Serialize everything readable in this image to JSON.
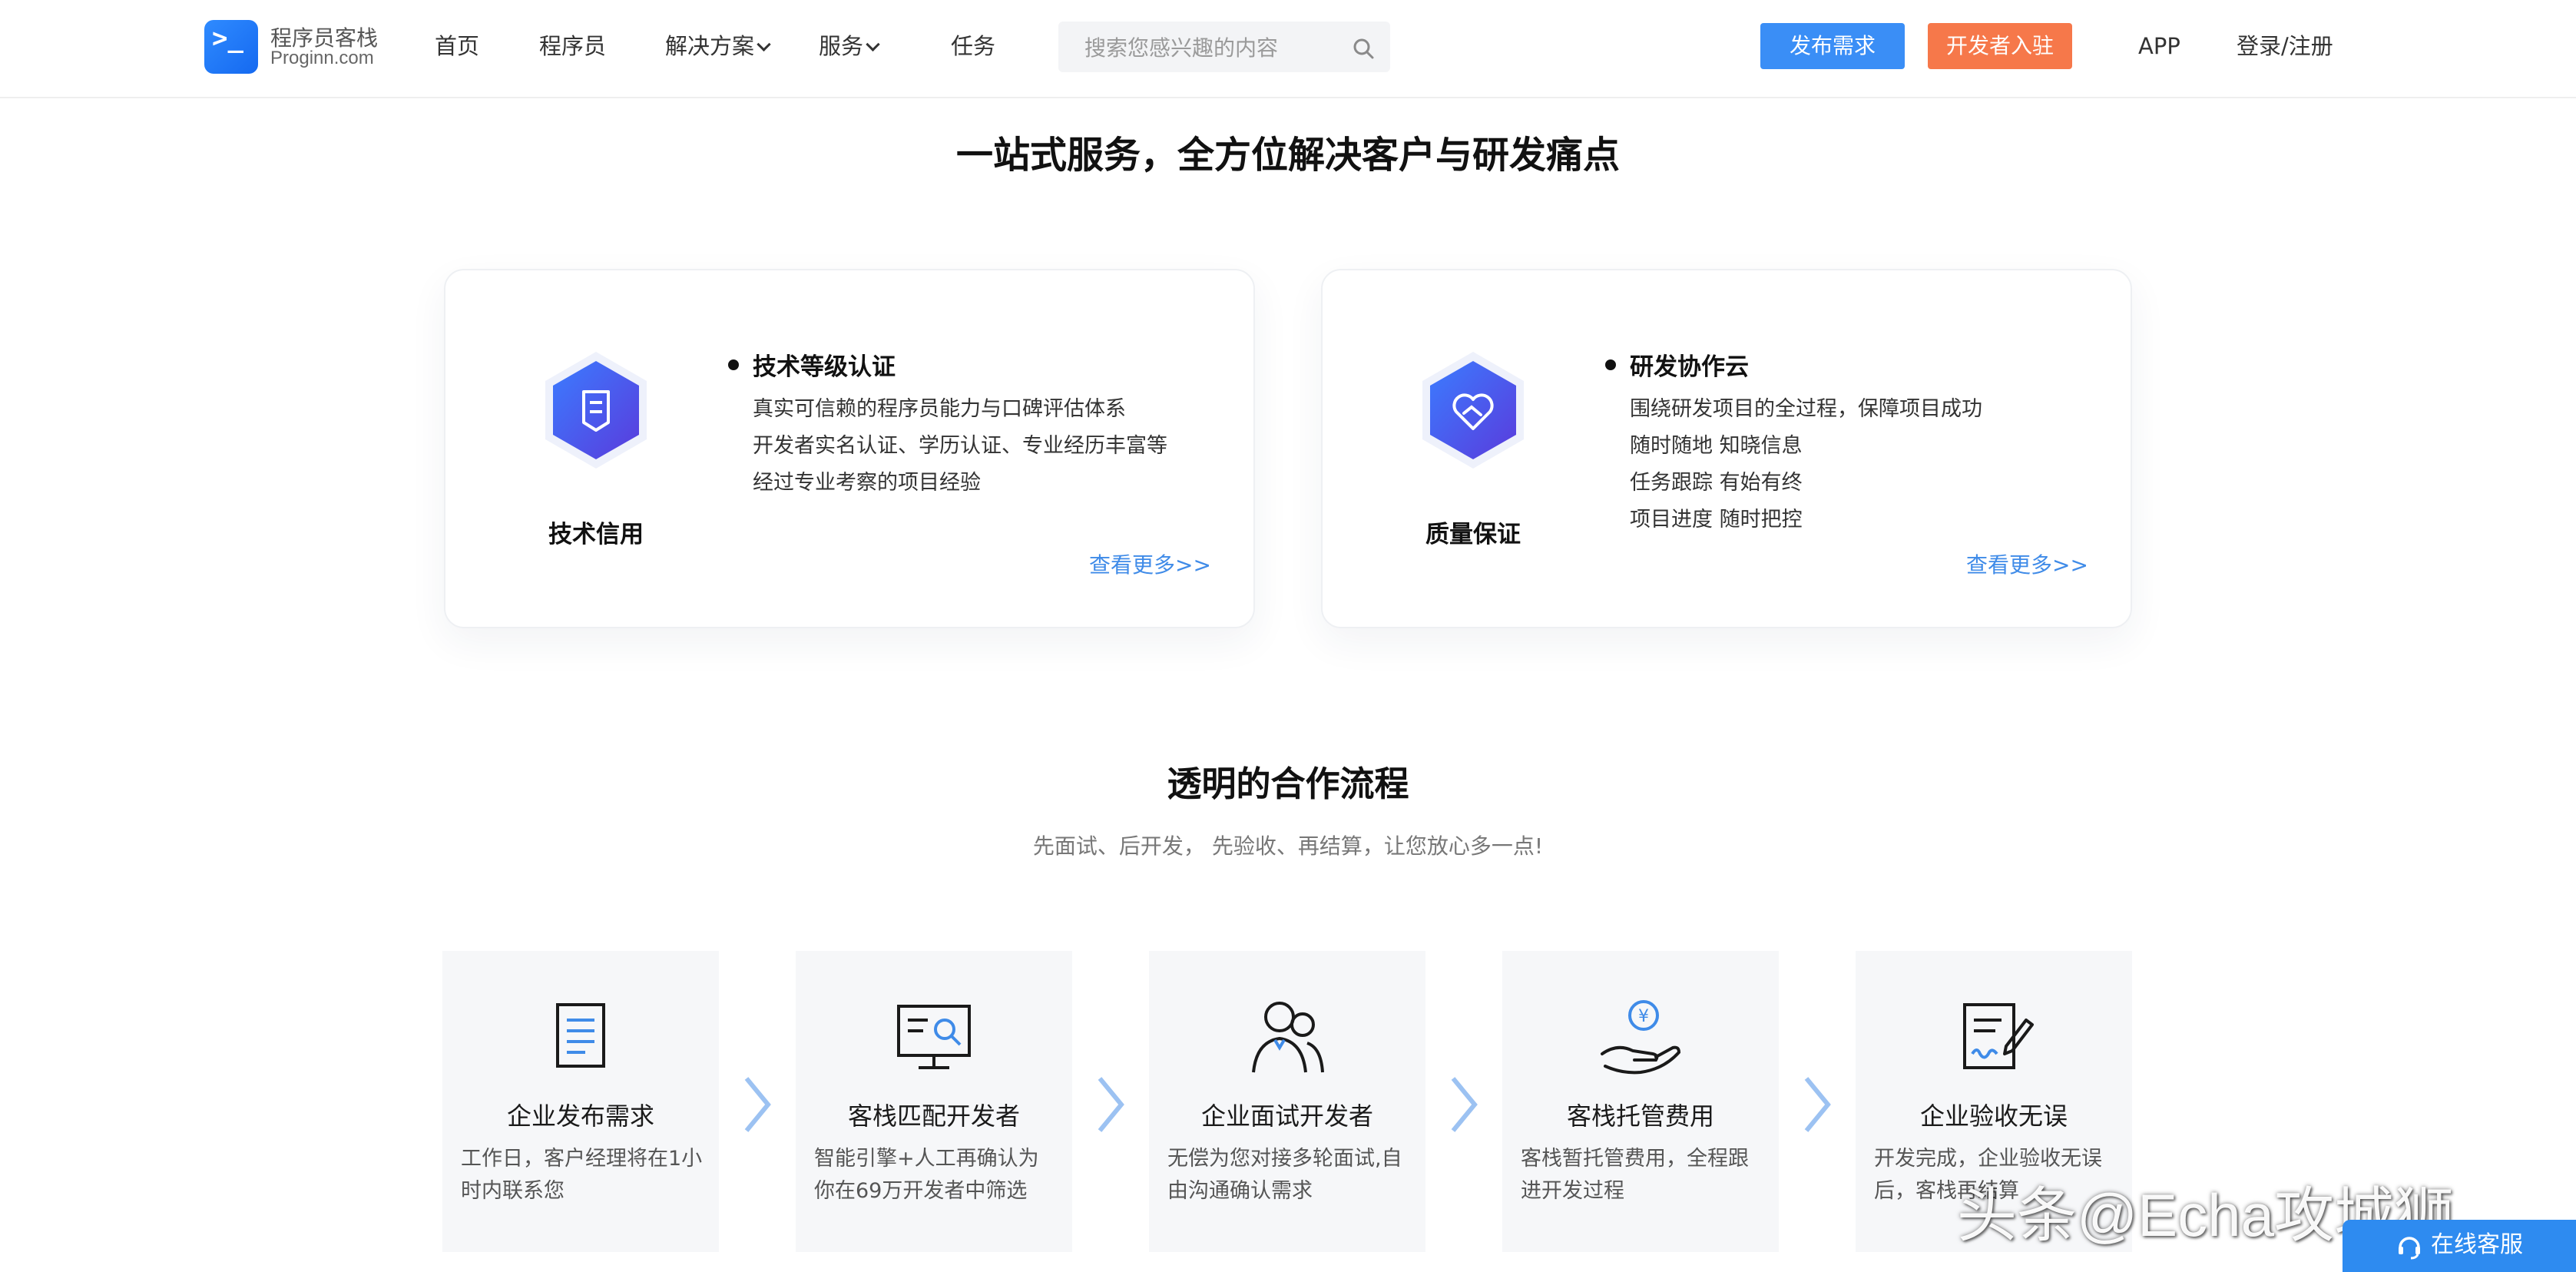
{
  "brand": {
    "name_cn": "程序员客栈",
    "name_en": "Proginn.com",
    "logo_glyph": ">_",
    "accent": "#3a8ef6"
  },
  "nav": {
    "items": [
      "首页",
      "程序员",
      "解决方案",
      "服务",
      "任务"
    ],
    "search_placeholder": "搜索您感兴趣的内容",
    "post_button": "发布需求",
    "dev_button": "开发者入驻",
    "app_link": "APP",
    "login_link": "登录/注册"
  },
  "section1": {
    "title": "一站式服务，全方位解决客户与研发痛点",
    "cards": [
      {
        "title": "技术信用",
        "icon": "shield-document-icon",
        "feature_title": "技术等级认证",
        "lines": [
          "真实可信赖的程序员能力与口碑评估体系",
          "开发者实名认证、学历认证、专业经历丰富等",
          "经过专业考察的项目经验"
        ],
        "more": "查看更多>>"
      },
      {
        "title": "质量保证",
        "icon": "handshake-heart-icon",
        "feature_title": "研发协作云",
        "lines": [
          "围绕研发项目的全过程，保障项目成功",
          "随时随地 知晓信息",
          "任务跟踪 有始有终",
          "项目进度 随时把控"
        ],
        "more": "查看更多>>"
      }
    ]
  },
  "section2": {
    "title": "透明的合作流程",
    "subtitle": "先面试、后开发， 先验收、再结算，让您放心多一点!",
    "steps": [
      {
        "title": "企业发布需求",
        "desc": "工作日，客户经理将在1小时内联系您",
        "icon": "document-icon"
      },
      {
        "title": "客栈匹配开发者",
        "desc": "智能引擎+人工再确认为你在69万开发者中筛选",
        "icon": "monitor-search-icon"
      },
      {
        "title": "企业面试开发者",
        "desc": "无偿为您对接多轮面试,自由沟通确认需求",
        "icon": "people-icon"
      },
      {
        "title": "客栈托管费用",
        "desc": "客栈暂托管费用，全程跟进开发过程",
        "icon": "hand-coin-icon"
      },
      {
        "title": "企业验收无误",
        "desc": "开发完成，企业验收无误后，客栈再结算",
        "icon": "document-sign-icon"
      }
    ]
  },
  "overlay": {
    "watermark": "头条@Echa攻城狮",
    "service_button": "在线客服"
  }
}
